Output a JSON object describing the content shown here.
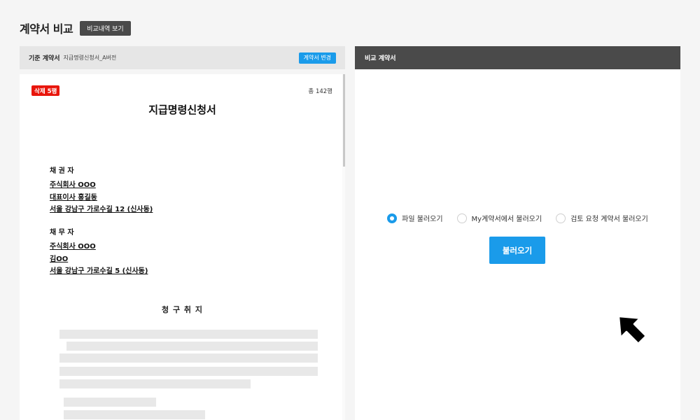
{
  "page": {
    "title": "계약서 비교",
    "history_button": "비교내역 보기"
  },
  "left_panel": {
    "label": "기준 계약서",
    "filename": "지급명령신청서_A버전",
    "change_button": "계약서 변경",
    "delete_badge": "삭제 5행",
    "total_lines": "총 142행",
    "doc_title": "지급명령신청서",
    "creditor": {
      "heading": "채 권 자",
      "lines": [
        "주식회사 OOO",
        "대표이사 홍길동",
        "서울 강남구 가로수길 12 (신사동)"
      ]
    },
    "debtor": {
      "heading": "채 무 자",
      "lines": [
        "주식회사 OOO",
        "김OO",
        "서울 강남구 가로수길 5 (신사동)"
      ]
    },
    "claim_title": "청 구 취 지"
  },
  "right_panel": {
    "label": "비교 계약서",
    "radio_options": [
      "파일 불러오기",
      "My계약서에서 불러오기",
      "검토 요청 계약서 불러오기"
    ],
    "selected_option": "파일 불러오기",
    "load_button": "불러오기"
  },
  "colors": {
    "accent": "#1a9bea",
    "dark_header": "#4a4a4a",
    "delete_badge": "#e8160c",
    "background": "#f5f5f5"
  },
  "icons": {
    "cursor": "arrow-cursor-icon"
  }
}
